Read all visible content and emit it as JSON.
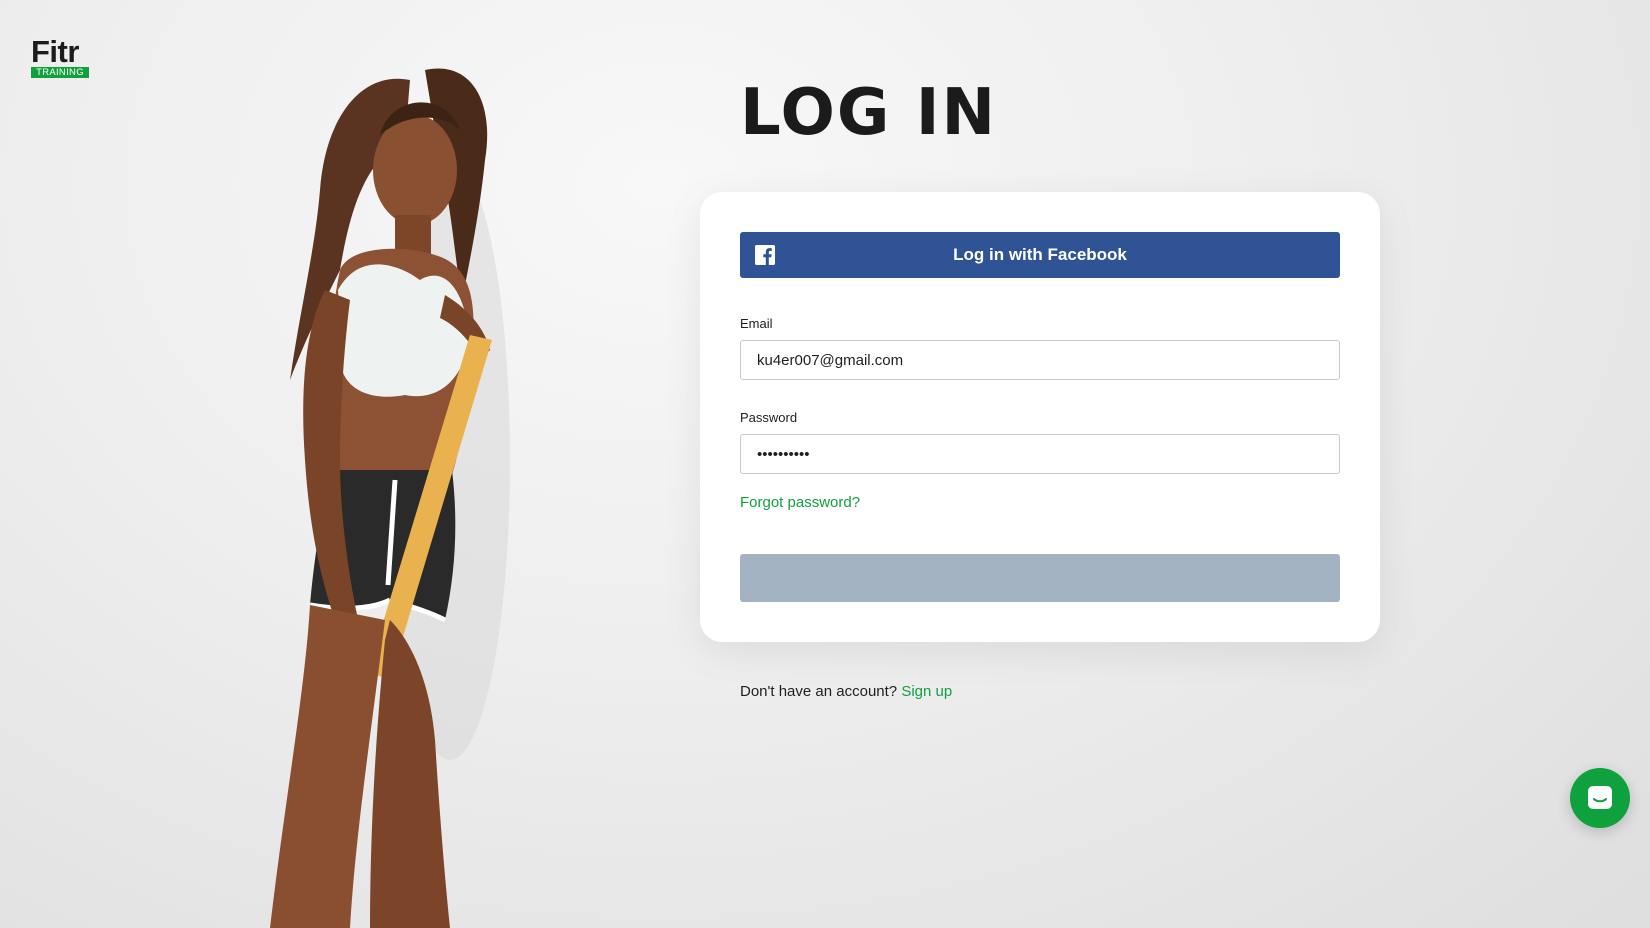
{
  "brand": {
    "name": "Fitr",
    "tagline": "TRAINING",
    "accent_color": "#10a13d"
  },
  "page": {
    "title": "LOG IN"
  },
  "login_card": {
    "facebook_button_label": "Log in with Facebook",
    "facebook_icon": "facebook-icon",
    "facebook_color": "#2f5394",
    "email": {
      "label": "Email",
      "value": "ku4er007@gmail.com"
    },
    "password": {
      "label": "Password",
      "value": "••••••••••"
    },
    "forgot_password_label": "Forgot password?",
    "submit_button_label": "",
    "submit_button_color": "#a4b3c2"
  },
  "signup": {
    "prompt": "Don't have an account?",
    "link_label": "Sign up"
  },
  "hero_image": {
    "icon": "fitness-model-image"
  },
  "chat": {
    "icon": "chat-icon"
  }
}
